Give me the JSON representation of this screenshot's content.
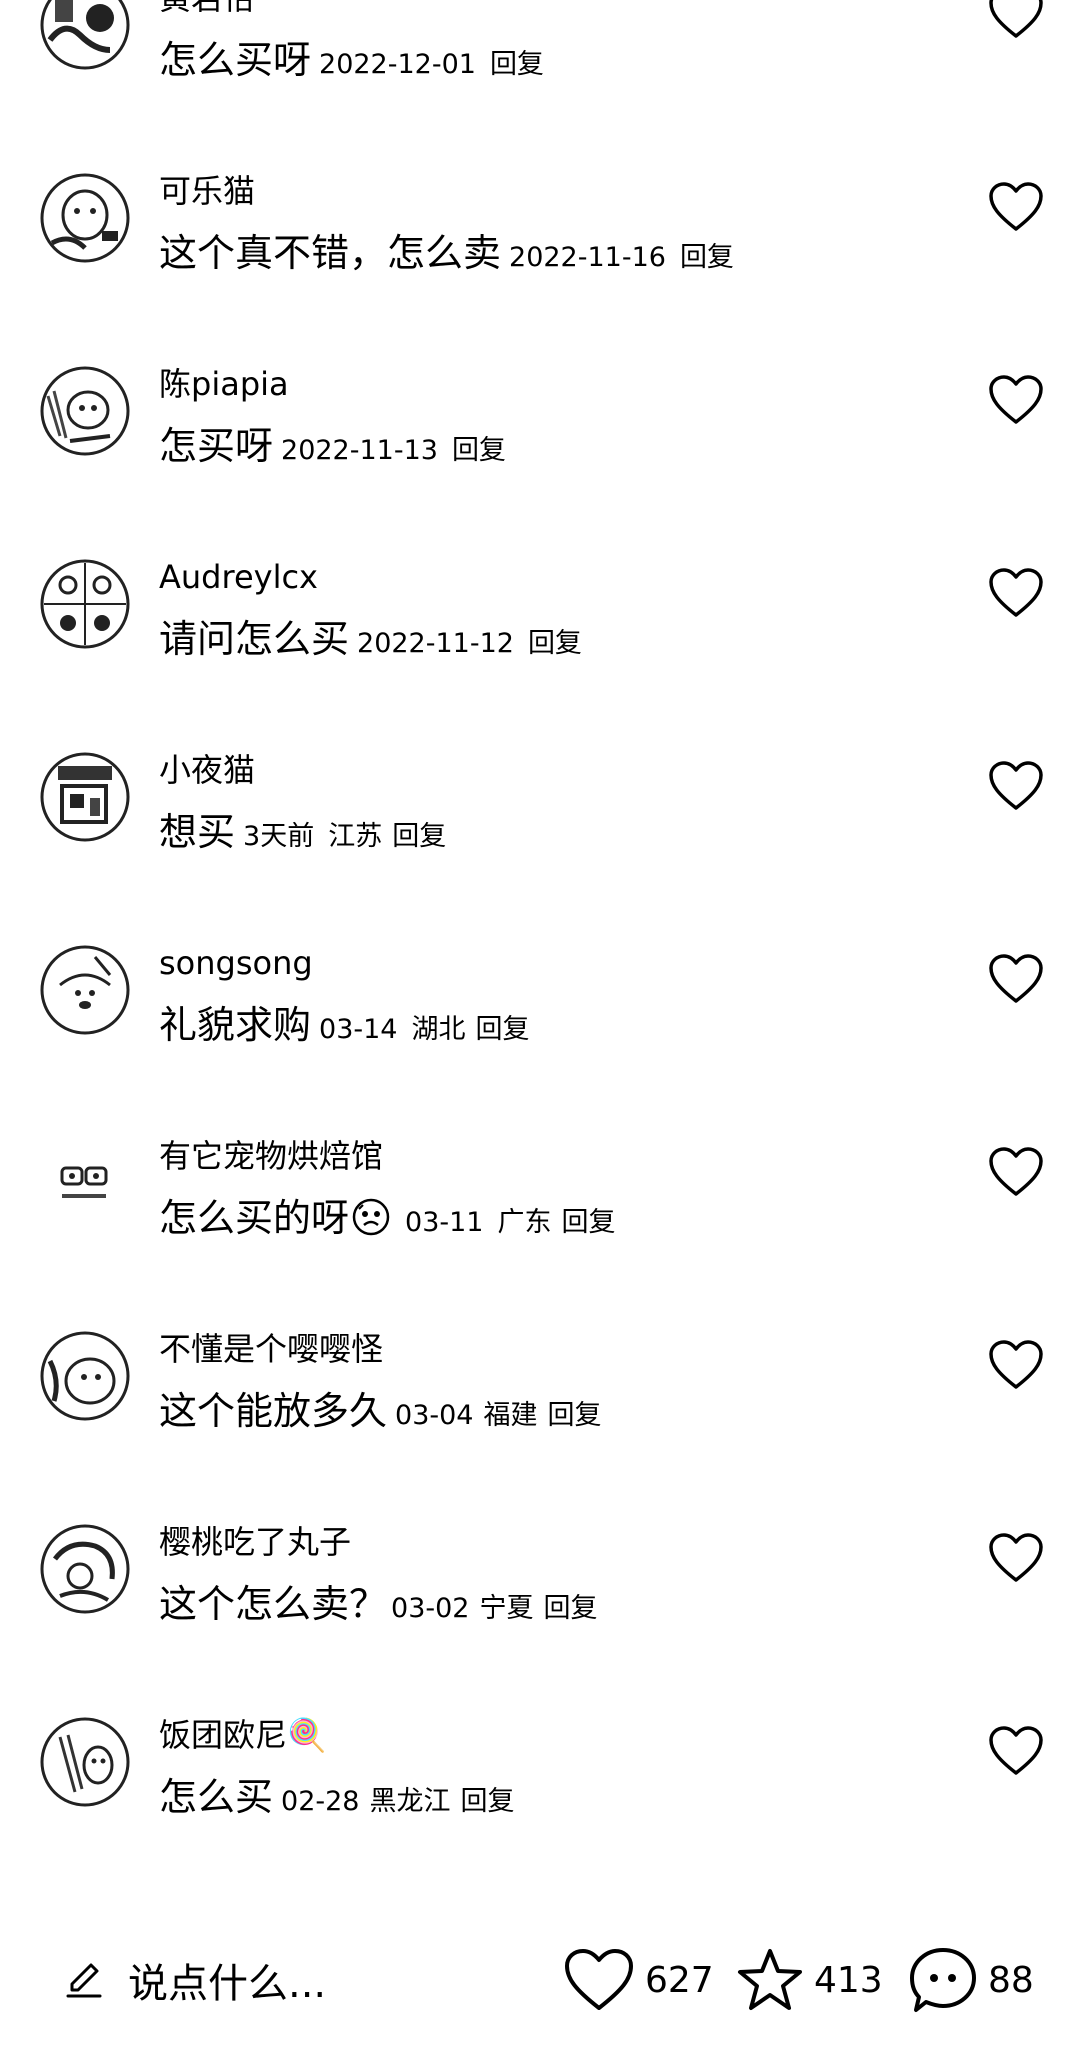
{
  "comments": [
    {
      "username": "黄若怡",
      "text": "怎么买呀",
      "time": "2022-12-01",
      "region": "",
      "reply": "回复"
    },
    {
      "username": "可乐猫",
      "text": "这个真不错，怎么卖",
      "time": "2022-11-16",
      "region": "",
      "reply": "回复"
    },
    {
      "username": "陈piapia",
      "text": "怎买呀",
      "time": "2022-11-13",
      "region": "",
      "reply": "回复"
    },
    {
      "username": "Audreylcx",
      "text": "请问怎么买",
      "time": "2022-11-12",
      "region": "",
      "reply": "回复"
    },
    {
      "username": "小夜猫",
      "text": "想买",
      "time": "3天前",
      "region": "江苏",
      "reply": "回复"
    },
    {
      "username": "songsong",
      "text": "礼貌求购",
      "time": "03-14",
      "region": "湖北",
      "reply": "回复"
    },
    {
      "username": "有它宠物烘焙馆",
      "text": "怎么买的呀",
      "time": "03-11",
      "region": "广东",
      "reply": "回复",
      "emoji": "nervous-emoji-icon"
    },
    {
      "username": "不懂是个嘤嘤怪",
      "text": "这个能放多久",
      "time": "03-04",
      "region": "福建",
      "reply": "回复"
    },
    {
      "username": "樱桃吃了丸子",
      "text": "这个怎么卖？",
      "time": "03-02",
      "region": "宁夏",
      "reply": "回复"
    },
    {
      "username": "饭团欧尼🍭",
      "text": "怎么买",
      "time": "02-28",
      "region": "黑龙江",
      "reply": "回复"
    }
  ],
  "bottom_bar": {
    "composer_placeholder": "说点什么...",
    "likes": "627",
    "favorites": "413",
    "comments": "88"
  },
  "icons": {
    "like": "heart-outline-icon",
    "favorite": "star-outline-icon",
    "comment": "chat-bubble-icon",
    "compose": "pen-icon"
  }
}
